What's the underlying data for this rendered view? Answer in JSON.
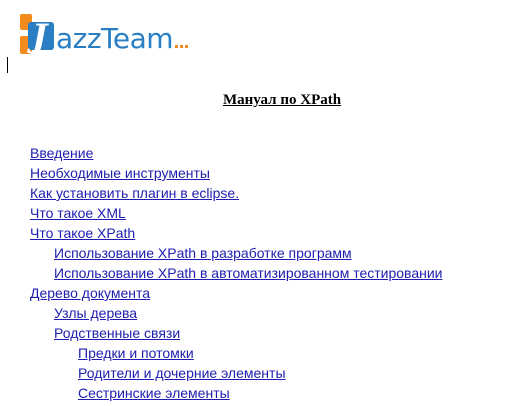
{
  "logo": {
    "letter": "J",
    "text": "azzTeam"
  },
  "title": "Мануал по XPath",
  "toc": [
    {
      "label": "Введение",
      "level": 1
    },
    {
      "label": "Необходимые инструменты",
      "level": 1
    },
    {
      "label": "Как  установить плагин в eclipse.",
      "level": 1
    },
    {
      "label": "Что такое XML",
      "level": 1
    },
    {
      "label": "Что такое XPath",
      "level": 1
    },
    {
      "label": "Использование XPath в разработке программ",
      "level": 2
    },
    {
      "label": "Использование XPath в автоматизированном тестировании",
      "level": 2
    },
    {
      "label": "Дерево документа",
      "level": 1
    },
    {
      "label": "Узлы дерева",
      "level": 2
    },
    {
      "label": "Родственные связи",
      "level": 2
    },
    {
      "label": "Предки и потомки",
      "level": 3
    },
    {
      "label": "Родители и дочерние элементы",
      "level": 3
    },
    {
      "label": "Сестринские элементы",
      "level": 3
    }
  ],
  "colors": {
    "link": "#1d1db0",
    "logo_blue": "#2a7fc4",
    "logo_orange": "#f28a1e"
  }
}
